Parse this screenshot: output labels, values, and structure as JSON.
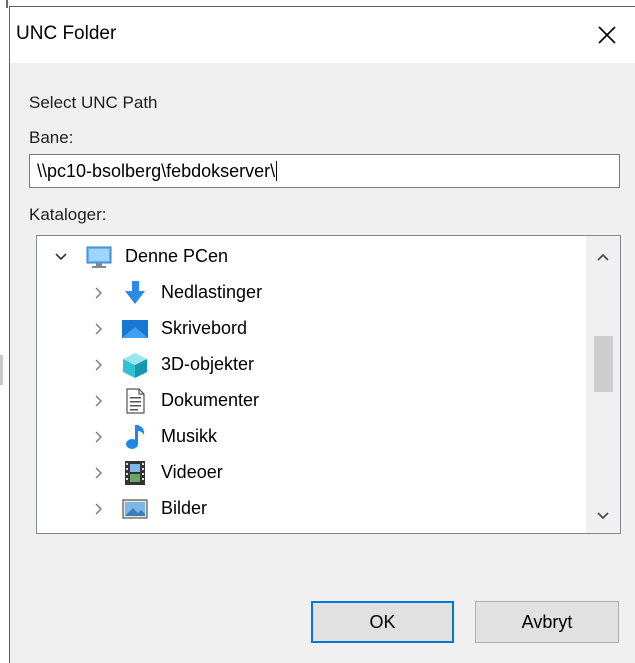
{
  "dialog": {
    "title": "UNC Folder",
    "close_icon": "close-icon",
    "select_label": "Select UNC Path",
    "path_label": "Bane:",
    "path_value": "\\\\pc10-bsolberg\\febdokserver\\",
    "folders_label": "Kataloger:"
  },
  "tree": {
    "root": {
      "label": "Denne PCen",
      "icon": "monitor-icon",
      "expanded": true
    },
    "items": [
      {
        "label": "Nedlastinger",
        "icon": "download-arrow-icon"
      },
      {
        "label": "Skrivebord",
        "icon": "desktop-icon"
      },
      {
        "label": "3D-objekter",
        "icon": "3d-cube-icon"
      },
      {
        "label": "Dokumenter",
        "icon": "document-icon"
      },
      {
        "label": "Musikk",
        "icon": "music-note-icon"
      },
      {
        "label": "Videoer",
        "icon": "film-icon"
      },
      {
        "label": "Bilder",
        "icon": "picture-icon"
      }
    ]
  },
  "buttons": {
    "ok": "OK",
    "cancel": "Avbryt"
  },
  "colors": {
    "accent": "#0078d7",
    "dialog_bg": "#f0f0f0"
  }
}
